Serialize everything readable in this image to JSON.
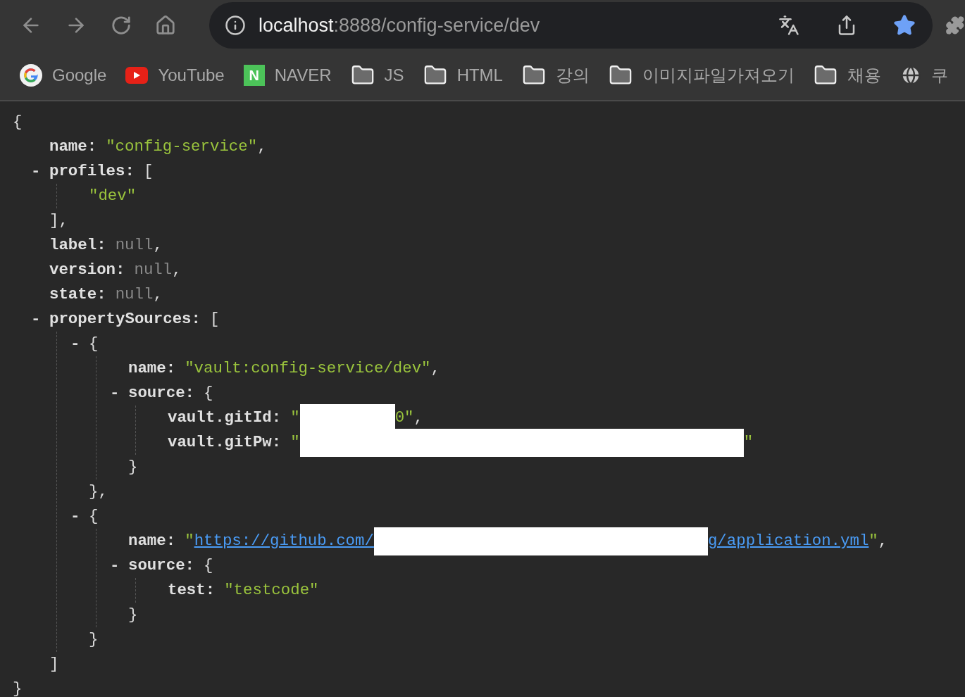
{
  "address": {
    "host": "localhost",
    "path": ":8888/config-service/dev",
    "bookmarked": true
  },
  "bookmarks": [
    {
      "kind": "google",
      "label": "Google"
    },
    {
      "kind": "youtube",
      "label": "YouTube"
    },
    {
      "kind": "naver",
      "logo_text": "N",
      "label": "NAVER"
    },
    {
      "kind": "folder",
      "label": "JS"
    },
    {
      "kind": "folder",
      "label": "HTML"
    },
    {
      "kind": "folder",
      "label": "강의"
    },
    {
      "kind": "folder",
      "label": "이미지파일가져오기"
    },
    {
      "kind": "folder",
      "label": "채용"
    },
    {
      "kind": "globe",
      "label": "쿠"
    }
  ],
  "document": {
    "kind": "container",
    "open": "{",
    "close": "}",
    "children": [
      {
        "kind": "value",
        "key": "name:",
        "segments": [
          {
            "kind": "string",
            "text": "\"config-service\""
          }
        ],
        "tail": ","
      },
      {
        "kind": "container",
        "toggle": "-",
        "expanded": true,
        "key": "profiles:",
        "open": "[",
        "close": "],",
        "children": [
          {
            "kind": "value",
            "segments": [
              {
                "kind": "string",
                "text": "\"dev\""
              }
            ]
          }
        ]
      },
      {
        "kind": "value",
        "key": "label:",
        "segments": [
          {
            "kind": "null",
            "text": "null"
          }
        ],
        "tail": ","
      },
      {
        "kind": "value",
        "key": "version:",
        "segments": [
          {
            "kind": "null",
            "text": "null"
          }
        ],
        "tail": ","
      },
      {
        "kind": "value",
        "key": "state:",
        "segments": [
          {
            "kind": "null",
            "text": "null"
          }
        ],
        "tail": ","
      },
      {
        "kind": "container",
        "toggle": "-",
        "expanded": true,
        "key": "propertySources:",
        "open": "[",
        "close": "]",
        "children": [
          {
            "kind": "container",
            "toggle": "-",
            "expanded": true,
            "open": "{",
            "close": "},",
            "children": [
              {
                "kind": "value",
                "key": "name:",
                "segments": [
                  {
                    "kind": "string",
                    "text": "\"vault:config-service/dev\""
                  }
                ],
                "tail": ","
              },
              {
                "kind": "container",
                "toggle": "-",
                "expanded": true,
                "key": "source:",
                "open": "{",
                "close": "}",
                "children": [
                  {
                    "kind": "value",
                    "key": "vault.gitId:",
                    "segments": [
                      {
                        "kind": "string",
                        "text": "\""
                      },
                      {
                        "kind": "redacted_short"
                      },
                      {
                        "kind": "string",
                        "text": "0\""
                      }
                    ],
                    "tail": ","
                  },
                  {
                    "kind": "value",
                    "key": "vault.gitPw:",
                    "segments": [
                      {
                        "kind": "string",
                        "text": "\""
                      },
                      {
                        "kind": "redacted_long"
                      },
                      {
                        "kind": "string",
                        "text": "\""
                      }
                    ]
                  }
                ]
              }
            ]
          },
          {
            "kind": "container",
            "toggle": "-",
            "expanded": true,
            "open": "{",
            "close": "}",
            "children": [
              {
                "kind": "value",
                "key": "name:",
                "segments": [
                  {
                    "kind": "string",
                    "text": "\""
                  },
                  {
                    "kind": "link",
                    "text": "https://github.com/"
                  },
                  {
                    "kind": "redacted_medium"
                  },
                  {
                    "kind": "link",
                    "text": "g/application.yml"
                  },
                  {
                    "kind": "string",
                    "text": "\""
                  }
                ],
                "tail": ","
              },
              {
                "kind": "container",
                "toggle": "-",
                "expanded": true,
                "key": "source:",
                "open": "{",
                "close": "}",
                "children": [
                  {
                    "kind": "value",
                    "key": "test:",
                    "segments": [
                      {
                        "kind": "string",
                        "text": "\"testcode\""
                      }
                    ]
                  }
                ]
              }
            ]
          }
        ]
      }
    ]
  }
}
